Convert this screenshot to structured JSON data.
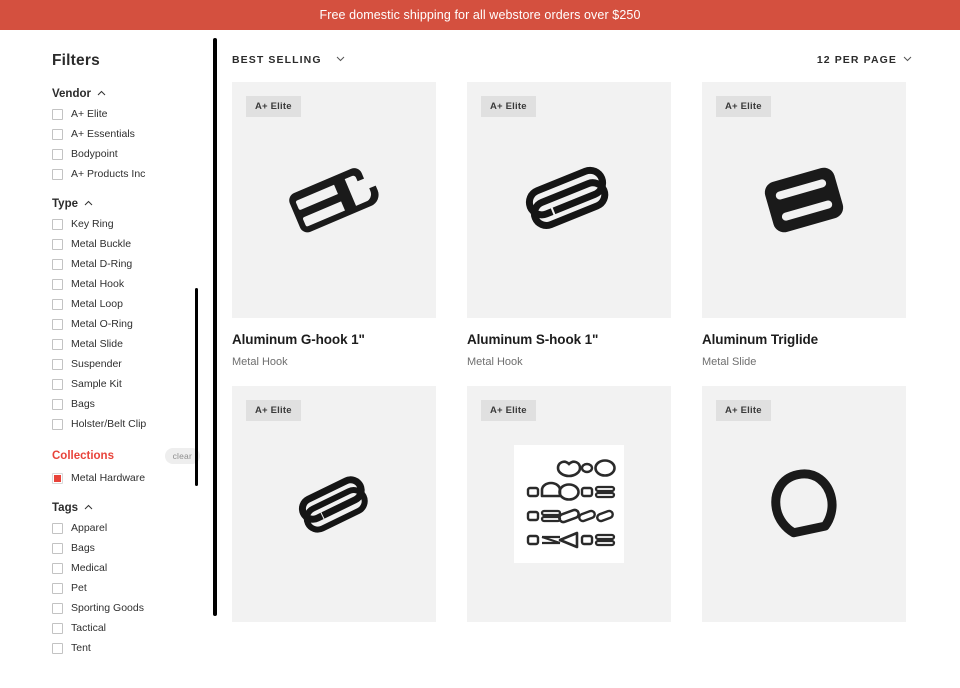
{
  "banner": {
    "text": "Free domestic shipping for all webstore orders over $250",
    "bg": "#d4503f"
  },
  "sidebar": {
    "title": "Filters",
    "groups": [
      {
        "name": "Vendor",
        "accent": false,
        "collapse_icon": "chevron-up-icon",
        "options": [
          {
            "label": "A+ Elite",
            "checked": false
          },
          {
            "label": "A+ Essentials",
            "checked": false
          },
          {
            "label": "Bodypoint",
            "checked": false
          },
          {
            "label": "A+ Products Inc",
            "checked": false
          }
        ]
      },
      {
        "name": "Type",
        "accent": false,
        "collapse_icon": "chevron-up-icon",
        "options": [
          {
            "label": "Key Ring",
            "checked": false
          },
          {
            "label": "Metal Buckle",
            "checked": false
          },
          {
            "label": "Metal D-Ring",
            "checked": false
          },
          {
            "label": "Metal Hook",
            "checked": false
          },
          {
            "label": "Metal Loop",
            "checked": false
          },
          {
            "label": "Metal O-Ring",
            "checked": false
          },
          {
            "label": "Metal Slide",
            "checked": false
          },
          {
            "label": "Suspender",
            "checked": false
          },
          {
            "label": "Sample Kit",
            "checked": false
          },
          {
            "label": "Bags",
            "checked": false
          },
          {
            "label": "Holster/Belt Clip",
            "checked": false
          }
        ]
      },
      {
        "name": "Collections",
        "accent": true,
        "accent_color": "#e8433a",
        "clear_label": "clear",
        "options": [
          {
            "label": "Metal Hardware",
            "checked": true
          }
        ]
      },
      {
        "name": "Tags",
        "accent": false,
        "collapse_icon": "chevron-up-icon",
        "options": [
          {
            "label": "Apparel",
            "checked": false
          },
          {
            "label": "Bags",
            "checked": false
          },
          {
            "label": "Medical",
            "checked": false
          },
          {
            "label": "Pet",
            "checked": false
          },
          {
            "label": "Sporting Goods",
            "checked": false
          },
          {
            "label": "Tactical",
            "checked": false
          },
          {
            "label": "Tent",
            "checked": false
          }
        ]
      }
    ]
  },
  "toolbar": {
    "sort_label": "BEST SELLING",
    "per_page_label": "12 PER PAGE"
  },
  "products": [
    {
      "badge": "A+ Elite",
      "name": "Aluminum G-hook 1\"",
      "type": "Metal Hook",
      "art": "g-hook"
    },
    {
      "badge": "A+ Elite",
      "name": "Aluminum S-hook 1\"",
      "type": "Metal Hook",
      "art": "s-hook"
    },
    {
      "badge": "A+ Elite",
      "name": "Aluminum Triglide",
      "type": "Metal Slide",
      "art": "triglide"
    },
    {
      "badge": "A+ Elite",
      "name": "",
      "type": "",
      "art": "s-hook-small"
    },
    {
      "badge": "A+ Elite",
      "name": "",
      "type": "",
      "art": "sample-kit"
    },
    {
      "badge": "A+ Elite",
      "name": "",
      "type": "",
      "art": "d-ring"
    }
  ]
}
